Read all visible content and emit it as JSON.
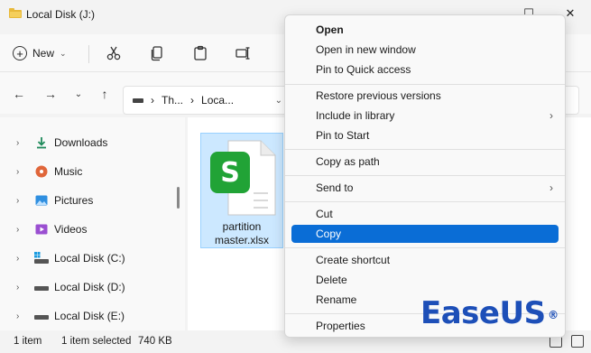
{
  "window": {
    "title": "Local Disk (J:)",
    "minimize": "—",
    "maximize": "☐",
    "close": "✕"
  },
  "toolbar": {
    "new_label": "New",
    "new_chevron": "⌄",
    "icons": [
      "cut-icon",
      "copy-icon",
      "paste-icon",
      "rename-icon"
    ]
  },
  "address_bar": {
    "segments": [
      "Th...",
      "Loca..."
    ],
    "separator": "›",
    "dropdown": "⌄"
  },
  "nav": {
    "back": "←",
    "forward": "→",
    "recent": "⌄",
    "up": "↑"
  },
  "sidebar": {
    "items": [
      {
        "label": "Downloads",
        "icon": "download-icon"
      },
      {
        "label": "Music",
        "icon": "music-icon"
      },
      {
        "label": "Pictures",
        "icon": "pictures-icon"
      },
      {
        "label": "Videos",
        "icon": "videos-icon"
      },
      {
        "label": "Local Disk (C:)",
        "icon": "drive-icon"
      },
      {
        "label": "Local Disk (D:)",
        "icon": "drive-icon"
      },
      {
        "label": "Local Disk (E:)",
        "icon": "drive-icon"
      }
    ],
    "expand_glyph": "›"
  },
  "content": {
    "file": {
      "name_line1": "partition",
      "name_line2": "master.xlsx",
      "badge_letter": "S",
      "icon": "spreadsheet-file-icon"
    }
  },
  "status": {
    "item_count": "1 item",
    "selection": "1 item selected",
    "size": "740 KB"
  },
  "context_menu": {
    "group1": [
      "Open",
      "Open in new window",
      "Pin to Quick access"
    ],
    "group2": [
      "Restore previous versions",
      "Include in library",
      "Pin to Start"
    ],
    "group3": [
      "Copy as path"
    ],
    "group4": [
      "Send to"
    ],
    "group5": [
      "Cut",
      "Copy"
    ],
    "group6": [
      "Create shortcut",
      "Delete",
      "Rename"
    ],
    "group7": [
      "Properties"
    ],
    "submenu_glyph": "›",
    "selected_item": "Copy"
  },
  "watermark": {
    "text": "EaseUS",
    "reg": "®"
  },
  "colors": {
    "accent": "#0a6dd6",
    "selection_bg": "#cce8ff",
    "logo_blue": "#1d4fb8",
    "spreadsheet_green": "#21a336"
  }
}
